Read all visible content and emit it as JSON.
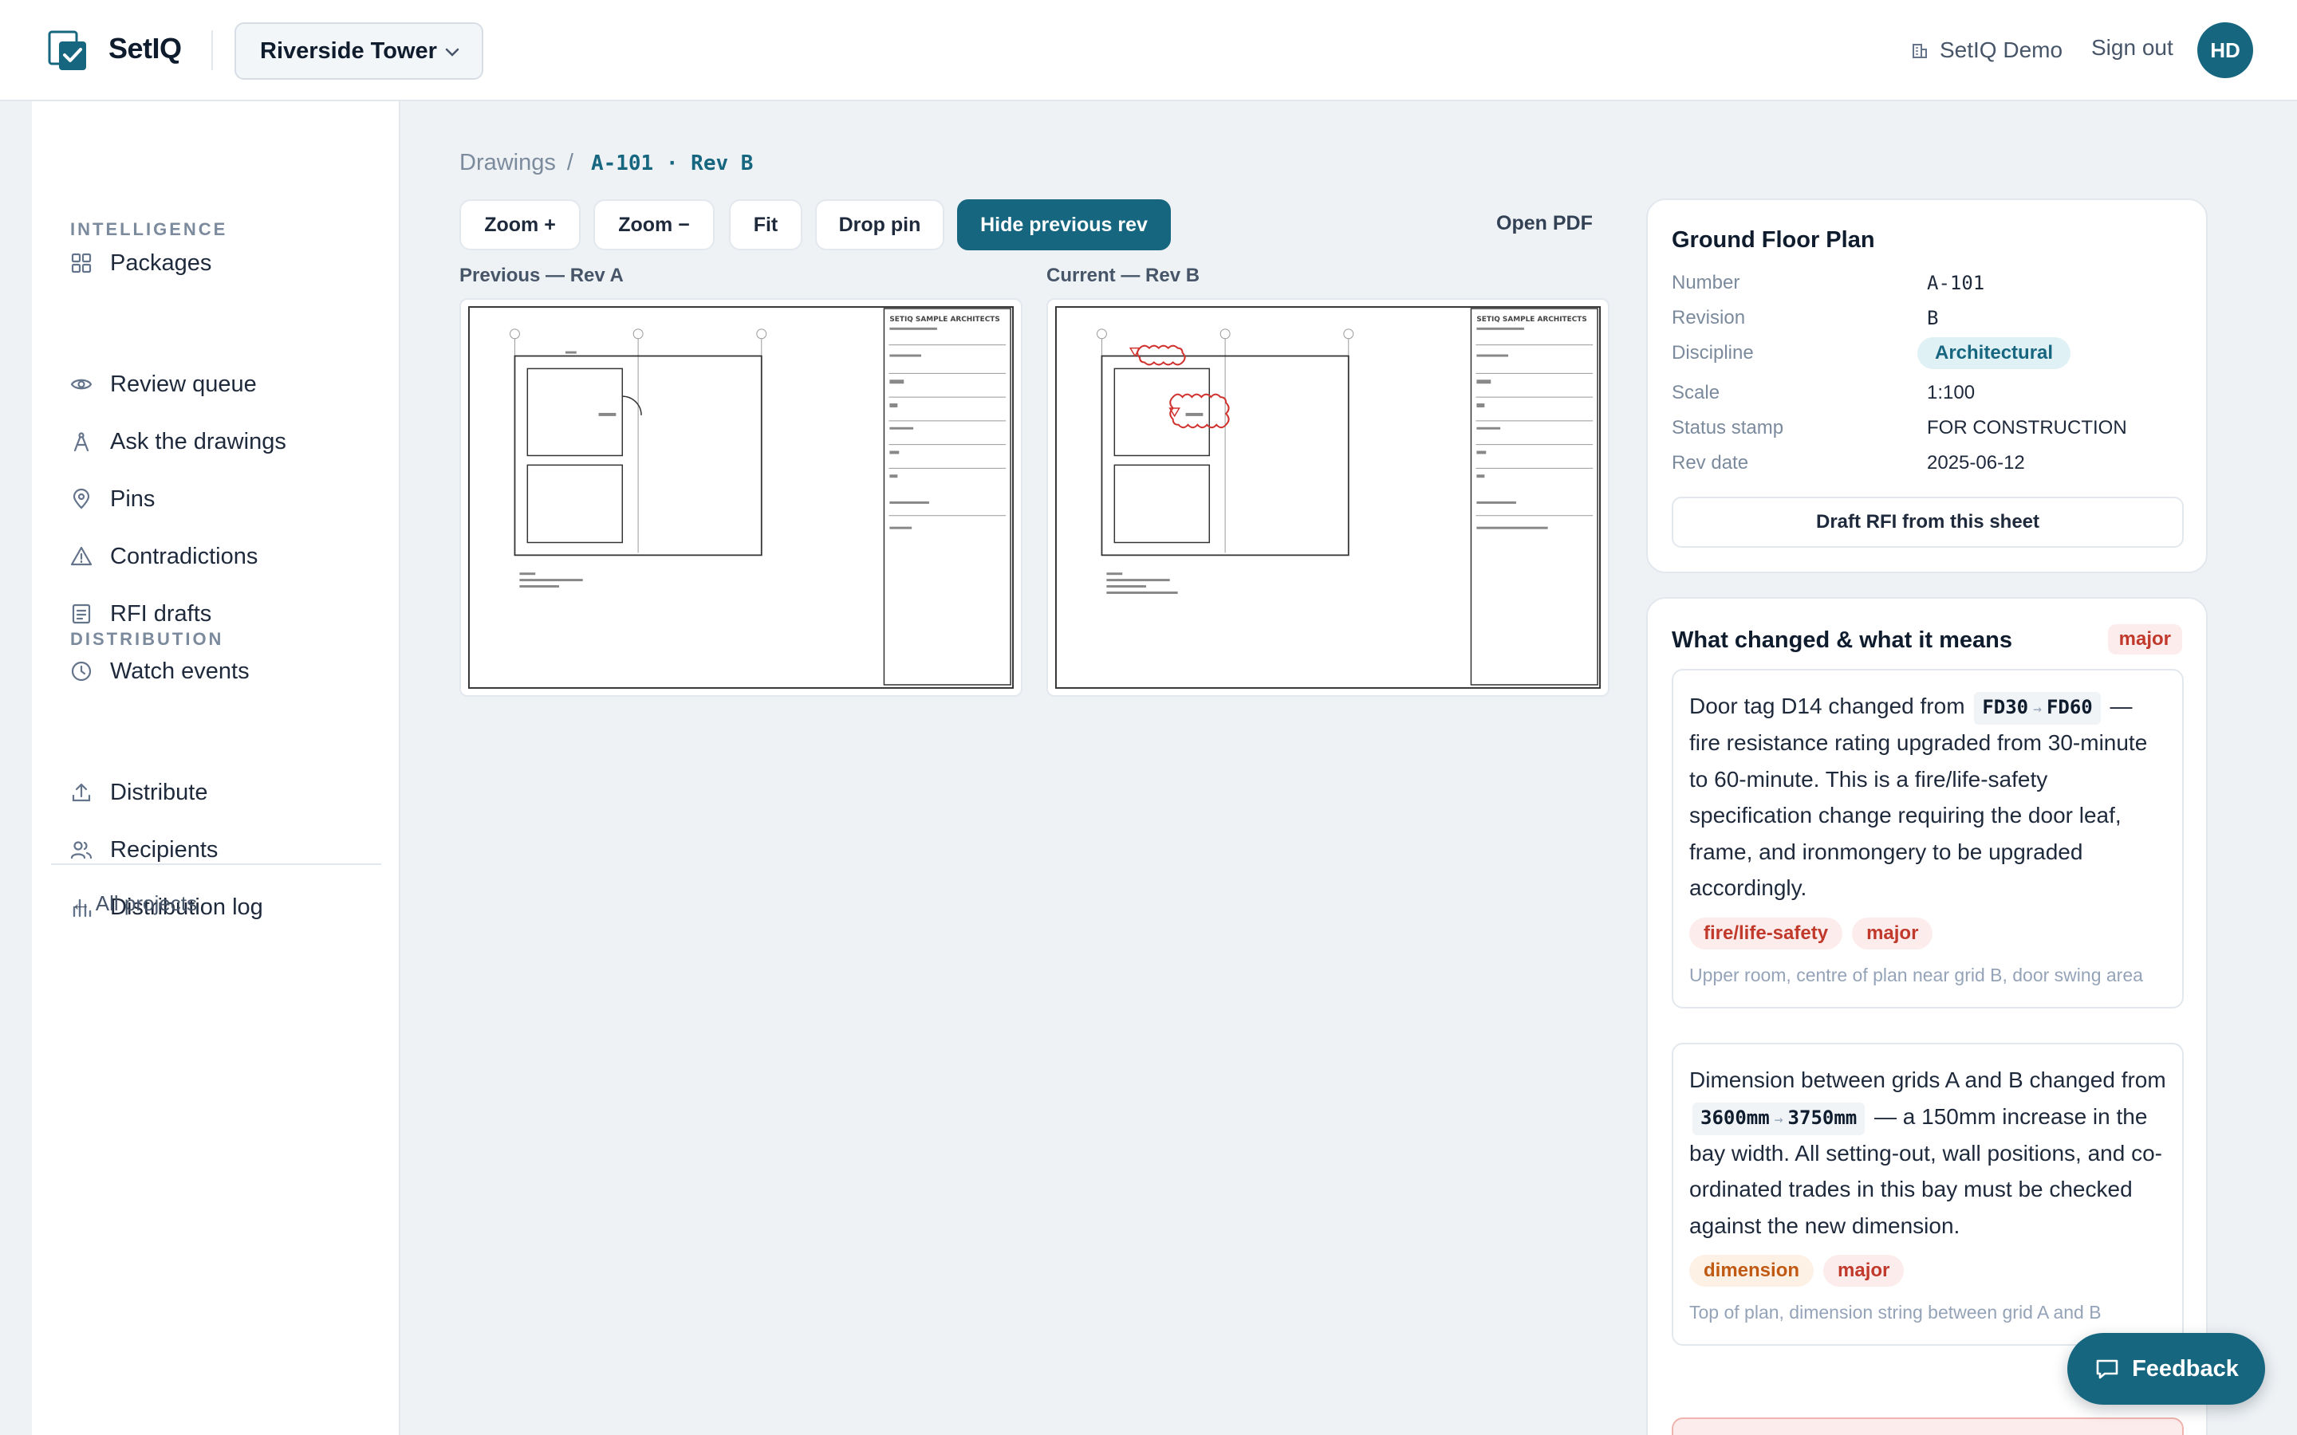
{
  "header": {
    "brand": "SetIQ",
    "project": "Riverside Tower",
    "org": "SetIQ Demo",
    "signout": "Sign out",
    "avatar_initials": "HD"
  },
  "sidebar": {
    "packages": "Packages",
    "intelligence_label": "INTELLIGENCE",
    "review_queue": "Review queue",
    "ask_drawings": "Ask the drawings",
    "pins": "Pins",
    "contradictions": "Contradictions",
    "rfi_drafts": "RFI drafts",
    "watch_events": "Watch events",
    "distribution_label": "DISTRIBUTION",
    "distribute": "Distribute",
    "recipients": "Recipients",
    "distribution_log": "Distribution log",
    "all_projects": "← All projects"
  },
  "breadcrumb": {
    "root": "Drawings",
    "separator": "/",
    "current": "A-101 · Rev B"
  },
  "toolbar": {
    "zoom_in": "Zoom +",
    "zoom_out": "Zoom −",
    "fit": "Fit",
    "drop_pin": "Drop pin",
    "hide_prev": "Hide previous rev",
    "open_pdf": "Open PDF"
  },
  "viewer": {
    "previous_label": "Previous — Rev A",
    "current_label": "Current — Rev B"
  },
  "sheet_info": {
    "title": "Ground Floor Plan",
    "fields": {
      "number_k": "Number",
      "number_v": "A-101",
      "revision_k": "Revision",
      "revision_v": "B",
      "discipline_k": "Discipline",
      "discipline_v": "Architectural",
      "scale_k": "Scale",
      "scale_v": "1:100",
      "status_k": "Status stamp",
      "status_v": "FOR CONSTRUCTION",
      "revdate_k": "Rev date",
      "revdate_v": "2025-06-12"
    },
    "rfi_button": "Draft RFI from this sheet"
  },
  "changes": {
    "title": "What changed & what it means",
    "severity": "major",
    "items": [
      {
        "pre": "Door tag D14 changed from",
        "from": "FD30",
        "to": "FD60",
        "post": "— fire resistance rating upgraded from 30-minute to 60-minute. This is a fire/life-safety specification change requiring the door leaf, frame, and ironmongery to be upgraded accordingly.",
        "tag1": "fire/life-safety",
        "tag2": "major",
        "location": "Upper room, centre of plan near grid B, door swing area"
      },
      {
        "pre": "Dimension between grids A and B changed from",
        "from": "3600mm",
        "to": "3750mm",
        "post": "— a 150mm increase in the bay width. All setting-out, wall positions, and co-ordinated trades in this bay must be checked against the new dimension.",
        "tag1": "dimension",
        "tag2": "major",
        "location": "Top of plan, dimension string between grid A and B"
      }
    ]
  },
  "feedback": "Feedback",
  "colors": {
    "accent": "#17667f",
    "major_red": "#c0392b",
    "dimension_orange": "#c05a12",
    "revision_cloud": "#d0312d"
  }
}
